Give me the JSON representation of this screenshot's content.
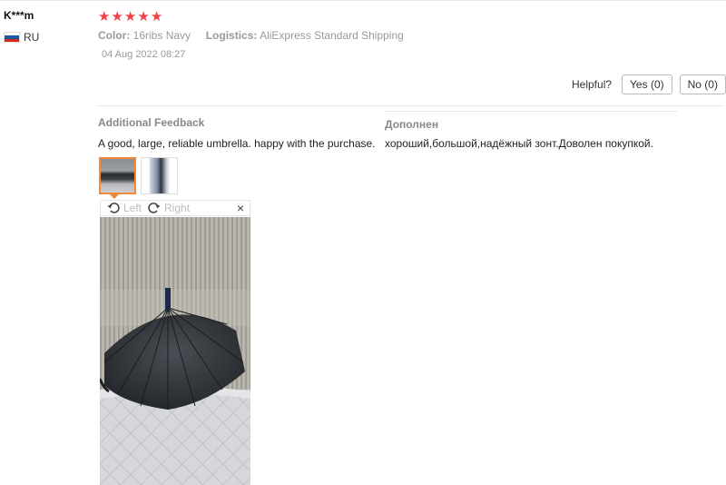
{
  "review": {
    "user_name": "K***m",
    "country_code": "RU",
    "rating": 5,
    "color_label": "Color:",
    "color_value": "16ribs Navy",
    "logistics_label": "Logistics:",
    "logistics_value": "AliExpress Standard Shipping",
    "date": "04 Aug 2022 08:27"
  },
  "helpful": {
    "label": "Helpful?",
    "yes": "Yes (0)",
    "no": "No (0)"
  },
  "additional": {
    "title": "Additional Feedback",
    "text": "A good, large, reliable umbrella. happy with the purchase.",
    "original_title": "Дополнен",
    "original_text": "хороший,большой,надёжный зонт.Доволен покупкой."
  },
  "viewer": {
    "rotate_left": "Left",
    "rotate_right": "Right",
    "close": "×"
  },
  "colors": {
    "star": "#f0414b",
    "selected_thumb": "#f08a3a"
  }
}
